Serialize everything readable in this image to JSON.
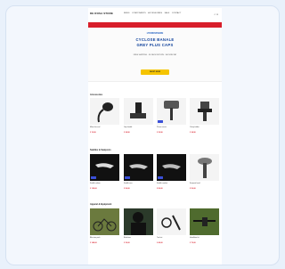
{
  "header": {
    "logo": "DE ROSA STORE",
    "nav": [
      "BIKES",
      "COMPONENTS",
      "ACCESSORIES",
      "SALE",
      "CONTACT"
    ]
  },
  "hero": {
    "pretitle": "HYDROSPHERE",
    "line1": "CYCLOSE BANALE",
    "line2": "GREY PLUS CAPS",
    "sub": "FREE SHIPPING · 30 DAYS RETURN · SECURE PAY",
    "cta": "SHOP NOW"
  },
  "sections": [
    {
      "title": "Accessories",
      "products": [
        {
          "name": "Mirror bar end",
          "price": "€ 19,90",
          "icon": "mirror-icon"
        },
        {
          "name": "Grip handle",
          "price": "€ 24,90",
          "icon": "grip-icon"
        },
        {
          "name": "Phone mount",
          "price": "€ 29,90",
          "icon": "mount-icon"
        },
        {
          "name": "Clamp holder",
          "price": "€ 34,90",
          "icon": "clamp-icon"
        }
      ]
    },
    {
      "title": "Saddles & Seatposts",
      "products": [
        {
          "name": "Saddle carbon",
          "price": "€ 129,00",
          "icon": "saddle-icon"
        },
        {
          "name": "Saddle race",
          "price": "€ 99,00",
          "icon": "saddle-icon"
        },
        {
          "name": "Saddle comfort",
          "price": "€ 89,00",
          "icon": "saddle-icon"
        },
        {
          "name": "Seatpost head",
          "price": "€ 59,00",
          "icon": "seatpost-icon"
        }
      ]
    },
    {
      "title": "Apparel & Equipment",
      "products": [
        {
          "name": "Bike tour pack",
          "price": "€ 149,00",
          "icon": "bike-icon"
        },
        {
          "name": "Balaclava",
          "price": "€ 39,00",
          "icon": "person-icon"
        },
        {
          "name": "Tool set",
          "price": "€ 49,00",
          "icon": "tools-icon"
        },
        {
          "name": "Handlebar kit",
          "price": "€ 79,00",
          "icon": "handlebar-icon"
        }
      ]
    }
  ]
}
